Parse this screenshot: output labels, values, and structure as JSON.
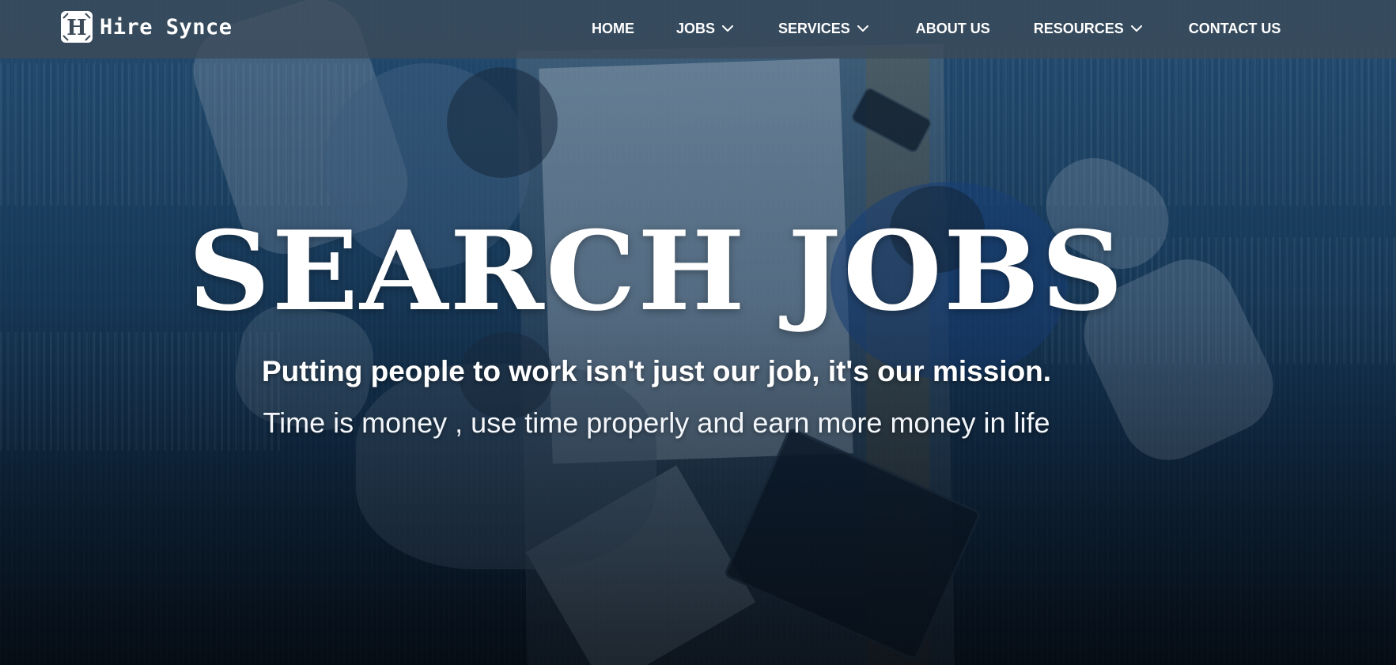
{
  "brand": {
    "logo_letter": "H",
    "name": "Hire Synce",
    "logo_icon": "h-letter-logo-icon"
  },
  "nav": {
    "items": [
      {
        "label": "HOME",
        "has_dropdown": false
      },
      {
        "label": "JOBS",
        "has_dropdown": true,
        "icon": "chevron-down-icon"
      },
      {
        "label": "SERVICES",
        "has_dropdown": true,
        "icon": "chevron-down-icon"
      },
      {
        "label": "ABOUT US",
        "has_dropdown": false
      },
      {
        "label": "RESOURCES",
        "has_dropdown": true,
        "icon": "chevron-down-icon"
      },
      {
        "label": "CONTACT US",
        "has_dropdown": false
      }
    ]
  },
  "hero": {
    "title": "SEARCH JOBS",
    "subtitle": "Putting people to work isn't just our job, it's our mission.",
    "tagline": "Time is money , use time properly and earn more money in life"
  },
  "colors": {
    "navbar_bg": "#3c4a58",
    "hero_overlay": "#1e4a72",
    "text": "#ffffff"
  }
}
